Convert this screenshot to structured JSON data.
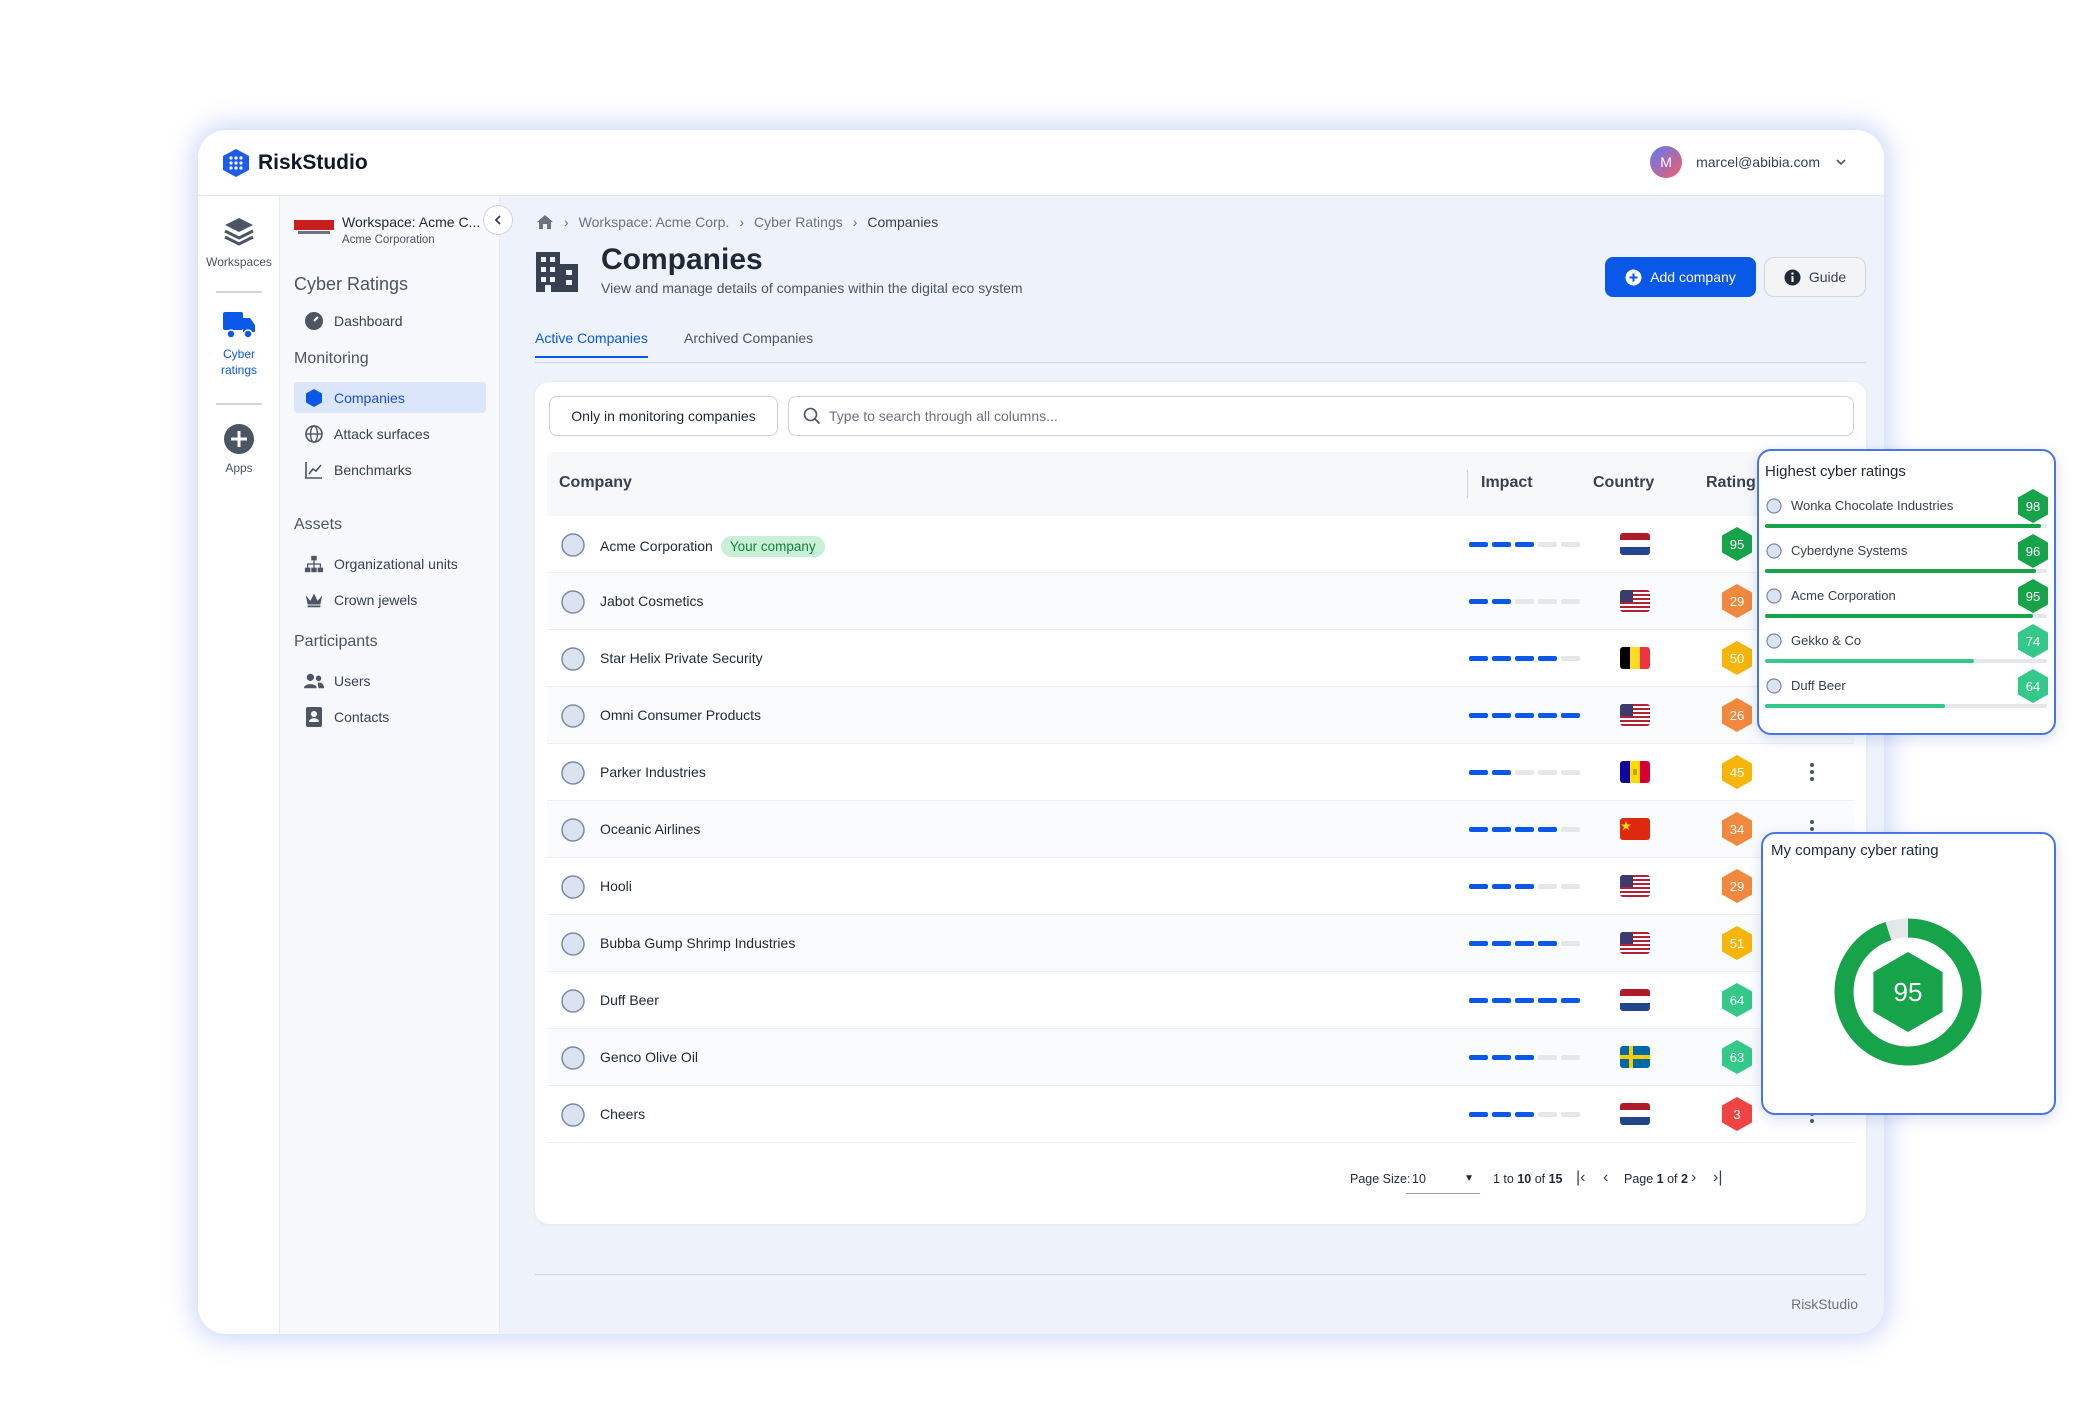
{
  "app": {
    "name": "RiskStudio"
  },
  "user": {
    "initial": "M",
    "email": "marcel@abibia.com"
  },
  "rail": [
    {
      "label": "Workspaces",
      "icon": "layers-icon"
    },
    {
      "label": "Cyber ratings",
      "icon": "truck-icon",
      "active": true
    },
    {
      "label": "Apps",
      "icon": "plus-circle-icon"
    }
  ],
  "workspace": {
    "title": "Workspace: Acme C...",
    "subtitle": "Acme Corporation"
  },
  "nav": {
    "heading": "Cyber Ratings",
    "dashboard": "Dashboard",
    "monitoring": {
      "label": "Monitoring",
      "items": [
        "Companies",
        "Attack surfaces",
        "Benchmarks"
      ]
    },
    "assets": {
      "label": "Assets",
      "items": [
        "Organizational units",
        "Crown jewels"
      ]
    },
    "participants": {
      "label": "Participants",
      "items": [
        "Users",
        "Contacts"
      ]
    }
  },
  "breadcrumb": [
    "Workspace: Acme Corp.",
    "Cyber Ratings",
    "Companies"
  ],
  "page": {
    "title": "Companies",
    "subtitle": "View and manage details of companies within the digital eco system",
    "add_button": "Add company",
    "guide_button": "Guide"
  },
  "tabs": [
    "Active Companies",
    "Archived Companies"
  ],
  "filter": {
    "toggle": "Only in monitoring companies",
    "search_placeholder": "Type to search through all columns..."
  },
  "table": {
    "columns": [
      "Company",
      "Impact",
      "Country",
      "Rating"
    ],
    "your_company_badge": "Your company",
    "rows": [
      {
        "name": "Acme Corporation",
        "yours": true,
        "impact": 3,
        "country": "nl",
        "rating": 95
      },
      {
        "name": "Jabot Cosmetics",
        "impact": 2,
        "country": "us",
        "rating": 29
      },
      {
        "name": "Star Helix Private Security",
        "impact": 4,
        "country": "be",
        "rating": 50
      },
      {
        "name": "Omni Consumer Products",
        "impact": 5,
        "country": "us",
        "rating": 26
      },
      {
        "name": "Parker Industries",
        "impact": 2,
        "country": "ad",
        "rating": 45
      },
      {
        "name": "Oceanic Airlines",
        "impact": 4,
        "country": "cn",
        "rating": 34
      },
      {
        "name": "Hooli",
        "impact": 3,
        "country": "us",
        "rating": 29
      },
      {
        "name": "Bubba Gump Shrimp Industries",
        "impact": 4,
        "country": "us",
        "rating": 51
      },
      {
        "name": "Duff Beer",
        "impact": 5,
        "country": "nl",
        "rating": 64
      },
      {
        "name": "Genco Olive Oil",
        "impact": 3,
        "country": "se",
        "rating": 63
      },
      {
        "name": "Cheers",
        "impact": 3,
        "country": "nl",
        "rating": 3
      }
    ]
  },
  "pager": {
    "size_label": "Page Size:",
    "size": "10",
    "range_from": "1",
    "range_to": "10",
    "range_total": "15",
    "page": "1",
    "pages": "2"
  },
  "highest": {
    "title": "Highest cyber ratings",
    "items": [
      {
        "name": "Wonka Chocolate Industries",
        "rating": 98
      },
      {
        "name": "Cyberdyne Systems",
        "rating": 96
      },
      {
        "name": "Acme Corporation",
        "rating": 95
      },
      {
        "name": "Gekko & Co",
        "rating": 74
      },
      {
        "name": "Duff Beer",
        "rating": 64
      }
    ]
  },
  "my_rating": {
    "title": "My company cyber rating",
    "value": 95
  },
  "footer": "RiskStudio",
  "colors": {
    "accent": "#0a58e8",
    "green_dark": "#16a34a",
    "green_light": "#34c98a",
    "yellow": "#f5b50a",
    "orange": "#f0883e",
    "red": "#ef4444"
  }
}
